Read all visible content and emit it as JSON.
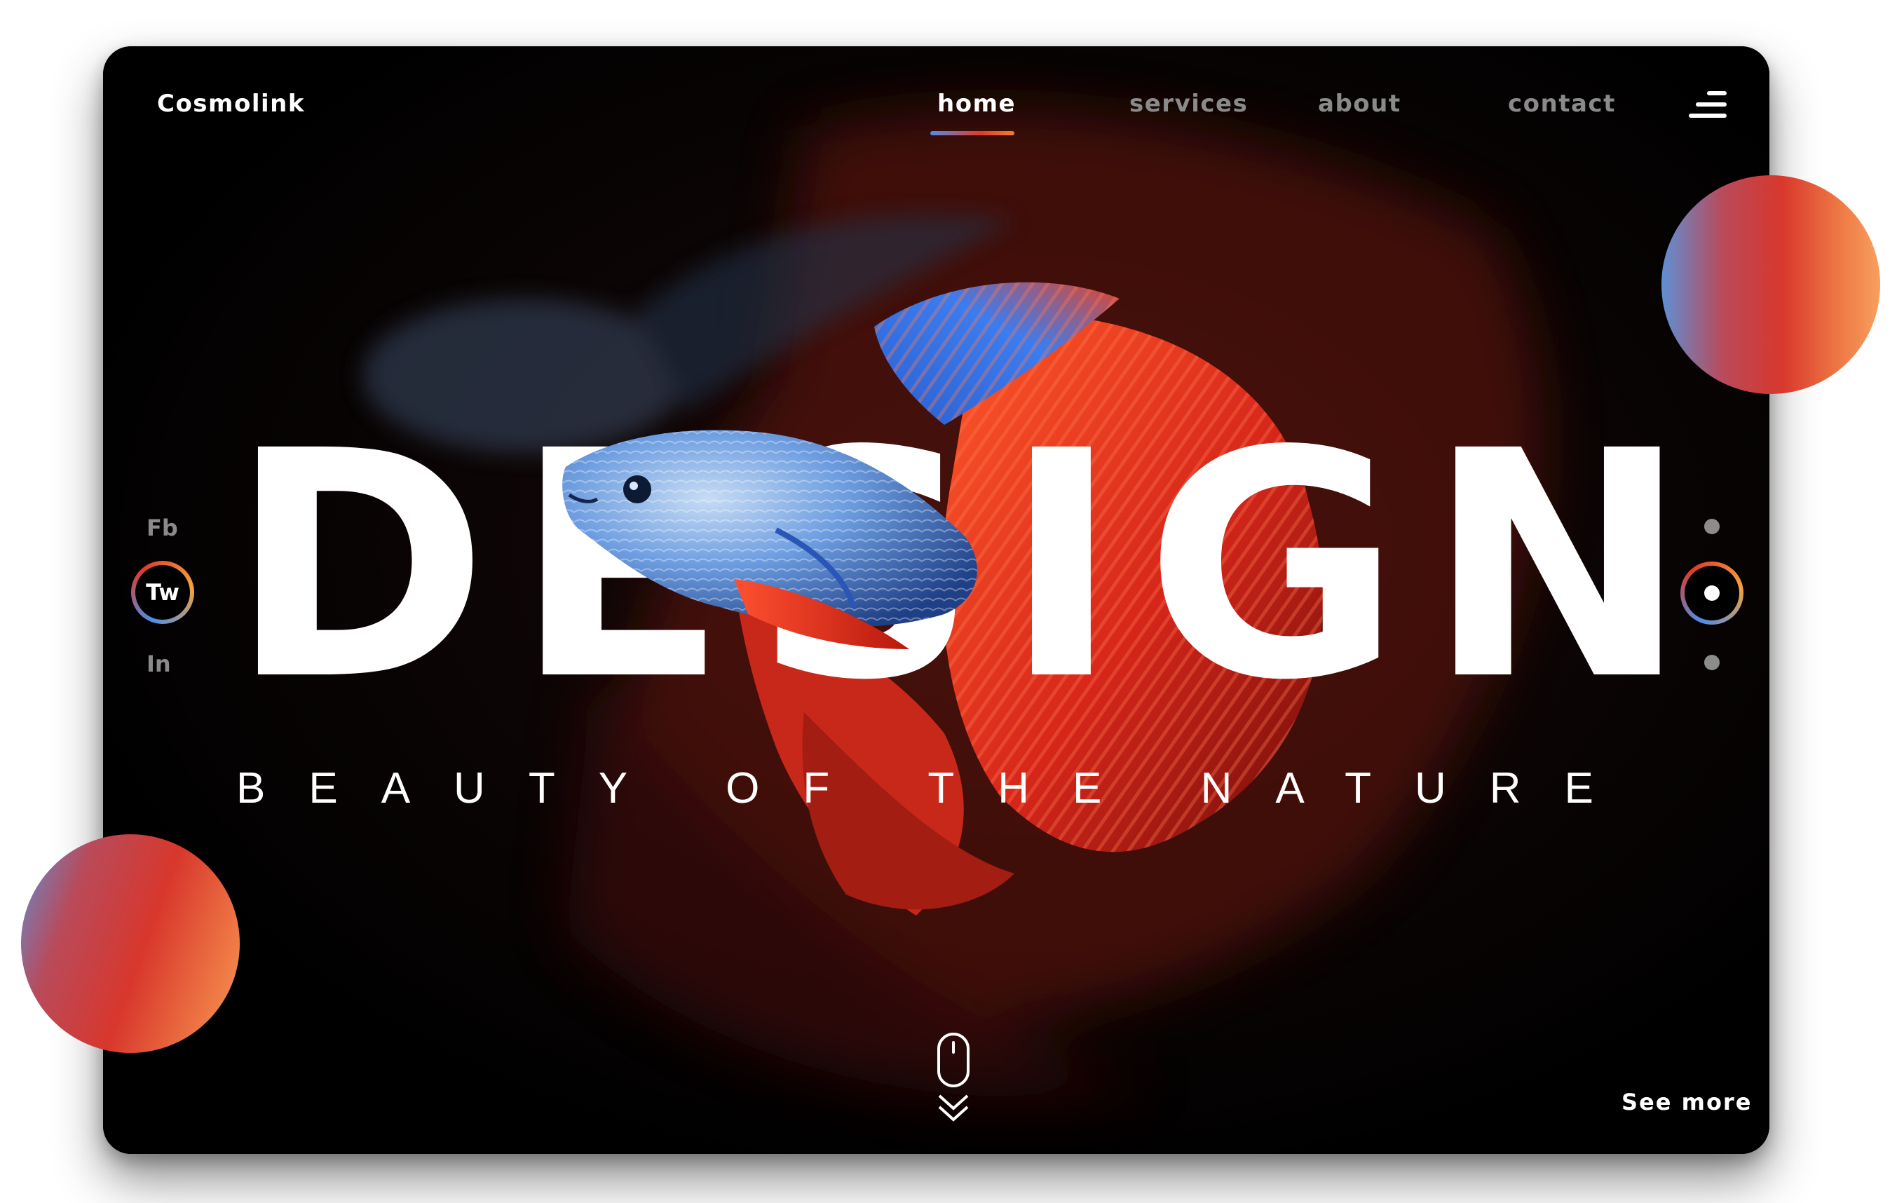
{
  "brand": {
    "name": "Cosmolink"
  },
  "nav": {
    "items": [
      {
        "label": "home",
        "active": true
      },
      {
        "label": "services",
        "active": false
      },
      {
        "label": "about",
        "active": false
      },
      {
        "label": "contact",
        "active": false
      }
    ],
    "menu_icon": "hamburger-menu-icon"
  },
  "social": {
    "items": [
      {
        "label": "Fb",
        "active": false
      },
      {
        "label": "Tw",
        "active": true
      },
      {
        "label": "In",
        "active": false
      }
    ]
  },
  "hero": {
    "headline": "DESIGN",
    "tagline": "BEAUTY OF THE NATURE",
    "image": "betta-fish"
  },
  "slider": {
    "dots": 3,
    "active_index": 1
  },
  "footer": {
    "scroll_icon": "mouse-scroll-icon",
    "see_more_label": "See more"
  },
  "colors": {
    "background": "#000000",
    "accent_blue": "#4f8de6",
    "accent_red": "#e03a2a",
    "accent_orange": "#f57c2f",
    "muted_text": "#8a8a8a",
    "text": "#ffffff"
  }
}
